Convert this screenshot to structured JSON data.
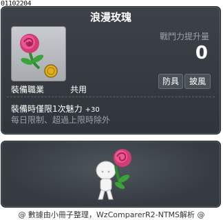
{
  "item_id": "01102204",
  "item": {
    "name": "浪漫玫瑰",
    "icon": "rose-icon",
    "stat_label": "戰鬥力提升量",
    "stat_value": "0",
    "tags": [
      "防具",
      "披風"
    ],
    "job_label": "裝備職業",
    "job_value": "共用",
    "effect_label": "裝備時僅限1次魅力",
    "effect_value": "+30",
    "limit_text": "每日限制、超過上限時除外"
  },
  "preview": {
    "icon": "character-with-rose-icon"
  },
  "footer": "@ 數據由小冊子整理，WzComparerR2-NTMS解析 @",
  "colors": {
    "panel_bg": "#353b40",
    "title_text": "#ffffff",
    "muted_text": "#9aa2aa",
    "rose_pink": "#e0407e",
    "leaf_green": "#3aa33a",
    "coin_gold": "#e0b020"
  }
}
